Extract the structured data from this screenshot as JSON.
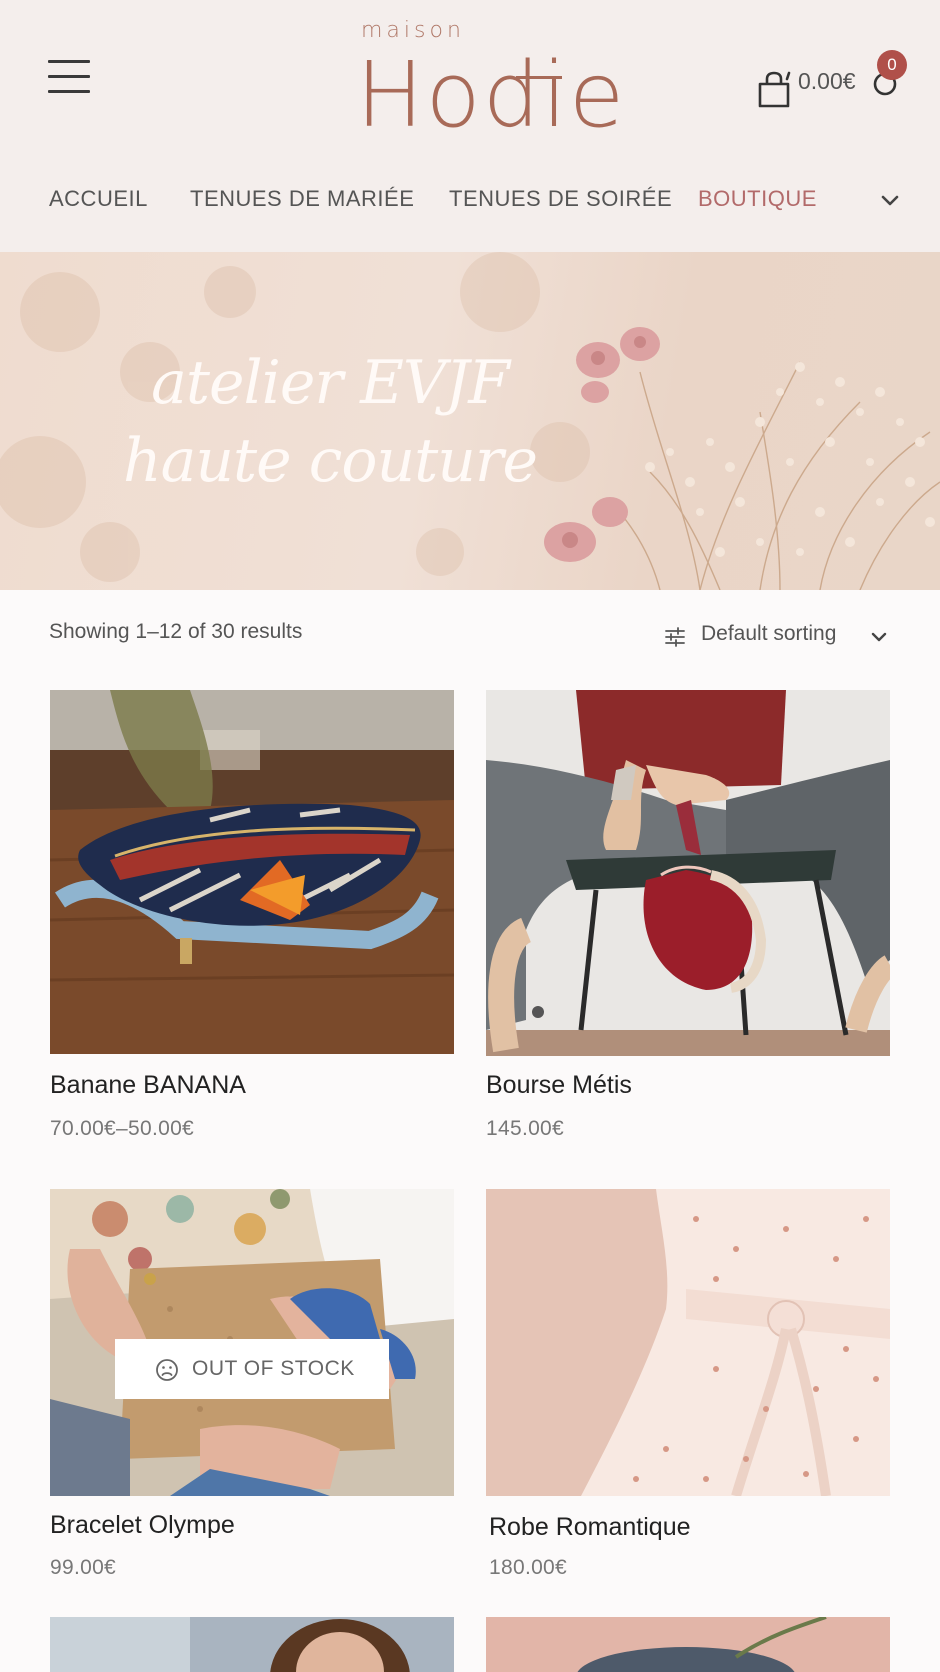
{
  "header": {
    "logo_small": "maison",
    "logo_big": "Hodie",
    "cart_amount": "0.00€",
    "cart_count": "0",
    "icons": [
      "menu-icon",
      "shopping-bag-icon",
      "user-icon",
      "chevron-down-icon"
    ]
  },
  "nav": {
    "items": [
      "ACCUEIL",
      "TENUES DE MARIÉE",
      "TENUES DE SOIRÉE",
      "BOUTIQUE"
    ],
    "active": "BOUTIQUE"
  },
  "hero": {
    "line1": "atelier EVJF",
    "line2": "haute couture"
  },
  "toolbar": {
    "results": "Showing 1–12 of 30 results",
    "sort_label": "Default sorting"
  },
  "products": [
    {
      "name": "Banane BANANA",
      "price": "70.00€–50.00€"
    },
    {
      "name": "Bourse Métis",
      "price": "145.00€"
    },
    {
      "name": "Bracelet Olympe",
      "price": "99.00€",
      "badge": "OUT OF STOCK"
    },
    {
      "name": "Robe Romantique",
      "price": "180.00€"
    }
  ],
  "colors": {
    "accent": "#b26a6a",
    "logo": "#a86a58",
    "header_bg": "#f4eeec",
    "badge": "#b0504a"
  }
}
